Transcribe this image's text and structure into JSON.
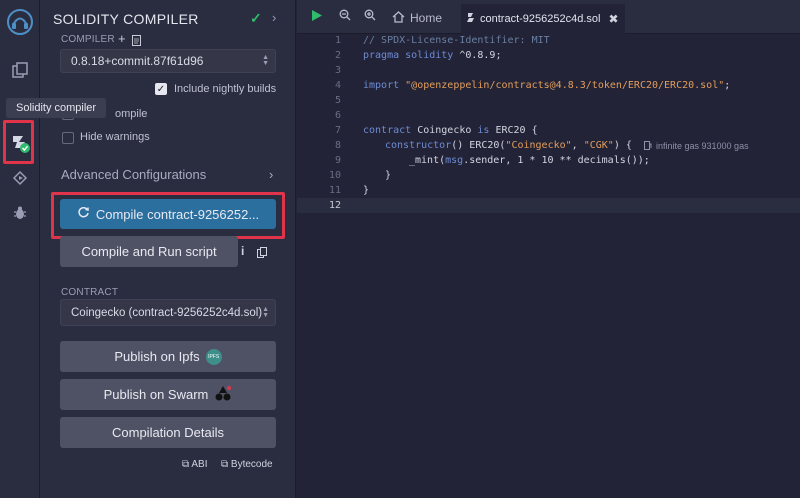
{
  "panel": {
    "title": "SOLIDITY COMPILER",
    "compiler_label": "COMPILER",
    "compiler_version": "0.8.18+commit.87f61d96",
    "include_nightly": "Include nightly builds",
    "auto_compile_partial": "ompile",
    "hide_warnings": "Hide warnings",
    "advanced": "Advanced Configurations",
    "compile_button": "Compile contract-9256252...",
    "compile_run_button": "Compile and Run script",
    "contract_label": "CONTRACT",
    "contract_value": "Coingecko (contract-9256252c4d.sol)",
    "publish_ipfs": "Publish on Ipfs",
    "ipfs_badge": "IPFS",
    "publish_swarm": "Publish on Swarm",
    "compilation_details": "Compilation Details",
    "abi": "ABI",
    "bytecode": "Bytecode"
  },
  "tooltip": "Solidity compiler",
  "editor": {
    "home": "Home",
    "active_tab": "contract-9256252c4d.sol",
    "lines": [
      "1",
      "2",
      "3",
      "4",
      "5",
      "6",
      "7",
      "8",
      "9",
      "10",
      "11",
      "12"
    ],
    "code": {
      "l1": "// SPDX-License-Identifier: MIT",
      "l2_kw": "pragma solidity",
      "l2_rest": " ^0.8.9;",
      "l4_kw": "import",
      "l4_str": "\"@openzeppelin/contracts@4.8.3/token/ERC20/ERC20.sol\"",
      "l4_end": ";",
      "l7_kw1": "contract",
      "l7_name": " Coingecko ",
      "l7_kw2": "is",
      "l7_rest": " ERC20 {",
      "l8_kw": "constructor",
      "l8_a": "() ERC20(",
      "l8_s1": "\"Coingecko\"",
      "l8_b": ", ",
      "l8_s2": "\"CGK\"",
      "l8_c": ") {",
      "l8_gas": "infinite gas 931000 gas",
      "l9_a": "_mint(",
      "l9_kw": "msg",
      "l9_b": ".sender, 1 * 10 ** decimals());",
      "l10": "}",
      "l11": "}"
    }
  },
  "colors": {
    "accent": "#2b6f9f",
    "highlight": "#e0344b",
    "success": "#2fbb6b"
  }
}
